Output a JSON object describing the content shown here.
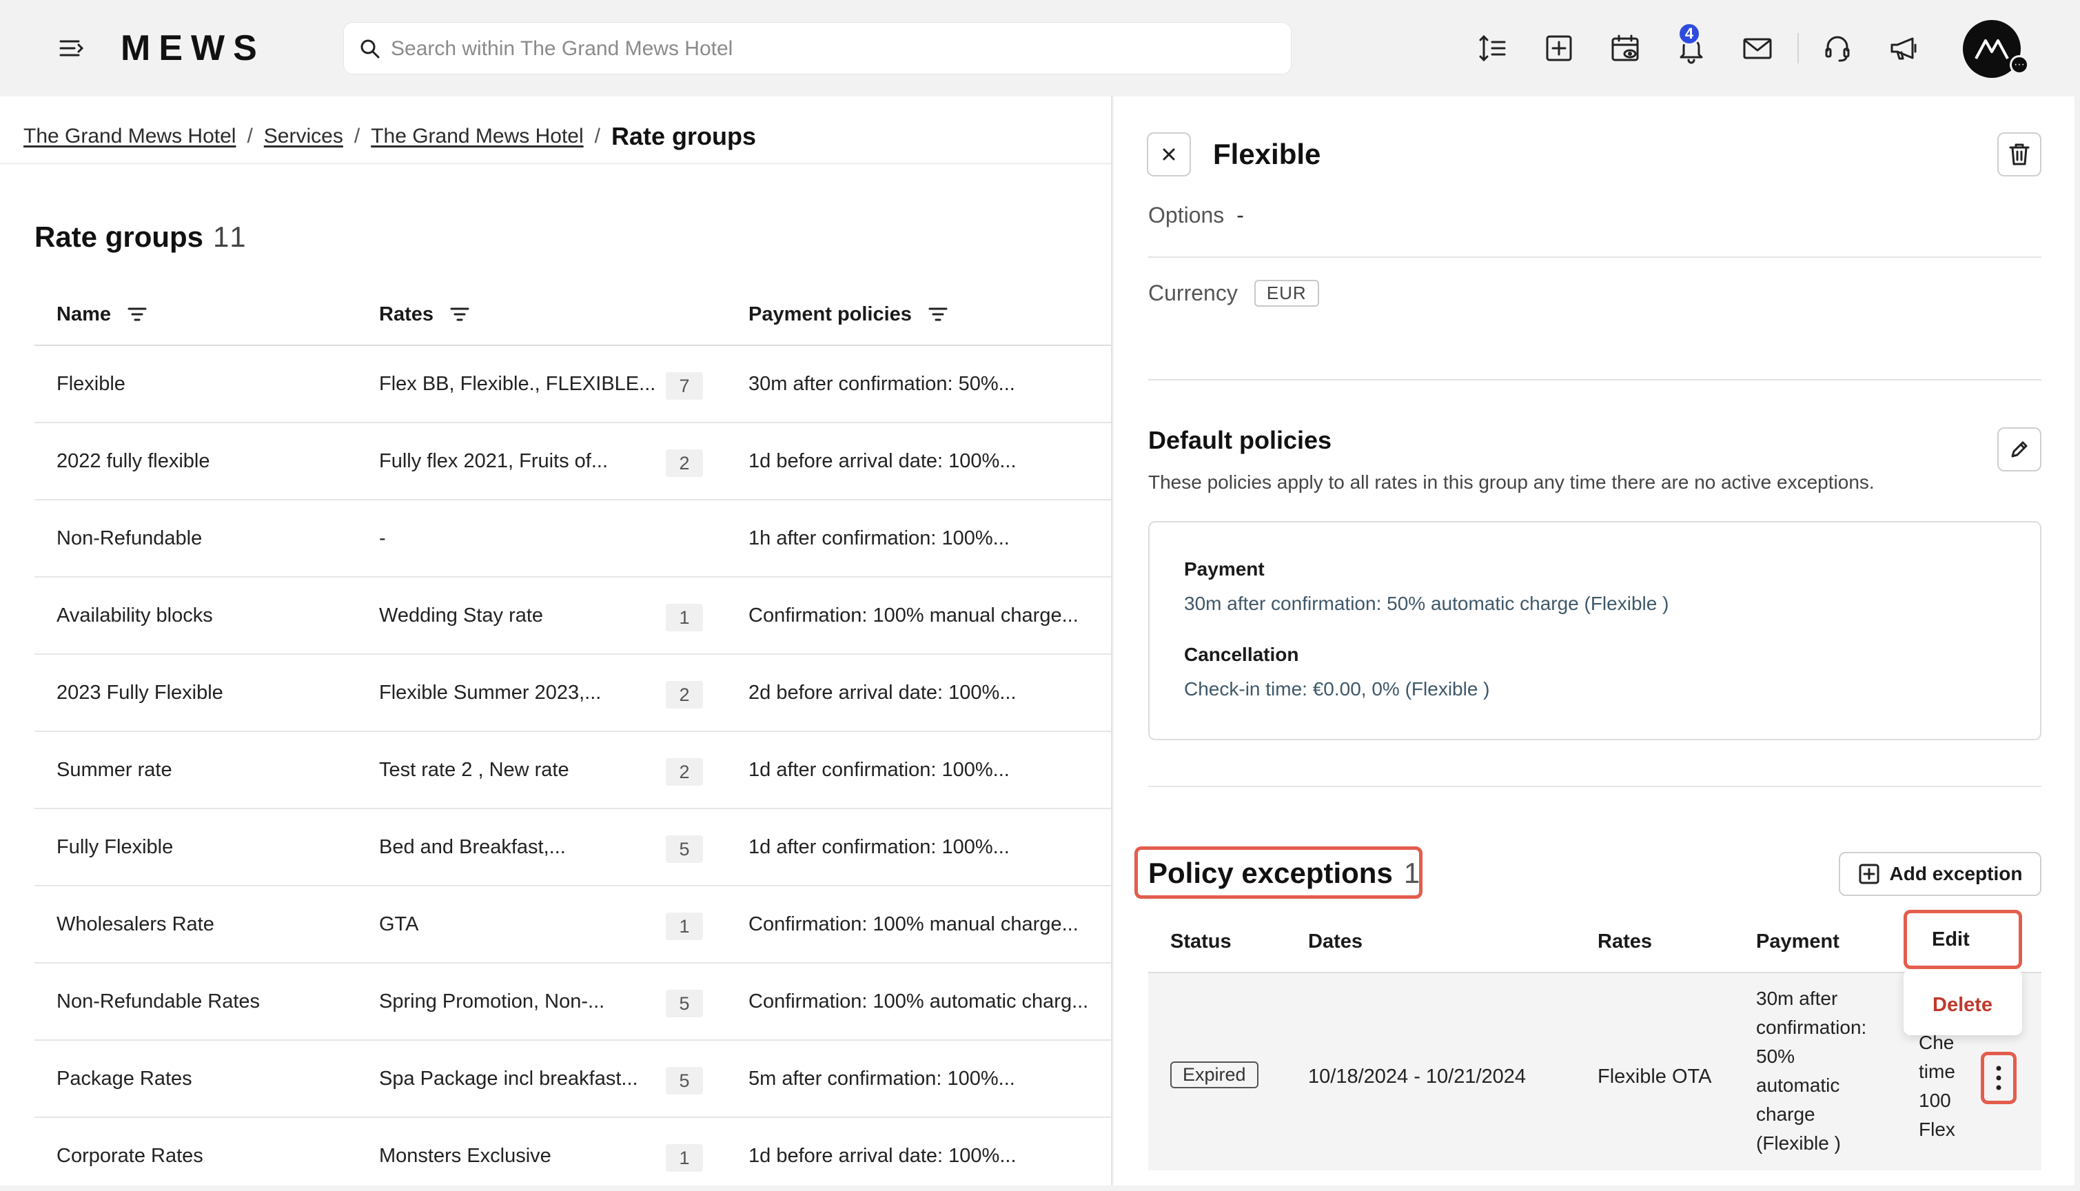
{
  "topbar": {
    "logo": "MEWS",
    "search_placeholder": "Search within The Grand Mews Hotel",
    "notification_count": "4",
    "icons": [
      "menu-icon",
      "search-icon",
      "sort-height-icon",
      "add-box-icon",
      "calendar-view-icon",
      "bell-icon",
      "mail-icon",
      "headset-icon",
      "megaphone-icon",
      "profile-avatar"
    ]
  },
  "breadcrumb": {
    "items": [
      "The Grand Mews Hotel",
      "Services",
      "The Grand Mews Hotel"
    ],
    "current": "Rate groups"
  },
  "rate_groups": {
    "title": "Rate groups",
    "count": "11",
    "columns": [
      "Name",
      "Rates",
      "Payment policies"
    ],
    "rows": [
      {
        "name": "Flexible",
        "rates": "Flex BB, Flexible., FLEXIBLE...",
        "count": "7",
        "policy": "30m after confirmation: 50%..."
      },
      {
        "name": "2022 fully flexible",
        "rates": "Fully flex 2021, Fruits of...",
        "count": "2",
        "policy": "1d before arrival date: 100%..."
      },
      {
        "name": "Non-Refundable",
        "rates": "-",
        "count": "",
        "policy": "1h after confirmation: 100%..."
      },
      {
        "name": "Availability blocks",
        "rates": "Wedding Stay rate",
        "count": "1",
        "policy": "Confirmation: 100% manual charge..."
      },
      {
        "name": "2023 Fully Flexible",
        "rates": "Flexible Summer 2023,...",
        "count": "2",
        "policy": "2d before arrival date: 100%..."
      },
      {
        "name": "Summer rate",
        "rates": "Test rate 2 , New rate",
        "count": "2",
        "policy": "1d after confirmation: 100%..."
      },
      {
        "name": "Fully Flexible",
        "rates": "Bed and Breakfast,...",
        "count": "5",
        "policy": "1d after confirmation: 100%..."
      },
      {
        "name": "Wholesalers Rate",
        "rates": "GTA",
        "count": "1",
        "policy": "Confirmation: 100% manual charge..."
      },
      {
        "name": "Non-Refundable Rates",
        "rates": "Spring Promotion, Non-...",
        "count": "5",
        "policy": "Confirmation: 100% automatic charg..."
      },
      {
        "name": "Package Rates",
        "rates": "Spa Package incl breakfast...",
        "count": "5",
        "policy": "5m after confirmation: 100%..."
      },
      {
        "name": "Corporate Rates",
        "rates": "Monsters Exclusive",
        "count": "1",
        "policy": "1d before arrival date: 100%..."
      }
    ]
  },
  "detail": {
    "title": "Flexible",
    "options_label": "Options",
    "options_value": "-",
    "currency_label": "Currency",
    "currency_value": "EUR",
    "default_policies_title": "Default policies",
    "default_policies_desc": "These policies apply to all rates in this group any time there are no active exceptions.",
    "payment_label": "Payment",
    "payment_value": "30m after confirmation: 50% automatic charge (Flexible )",
    "cancellation_label": "Cancellation",
    "cancellation_value": "Check-in time: €0.00, 0% (Flexible )",
    "exceptions_title": "Policy exceptions",
    "exceptions_count": "1",
    "add_exception_label": "Add exception",
    "exception_columns": [
      "Status",
      "Dates",
      "Rates",
      "Payment"
    ],
    "exception_row": {
      "status": "Expired",
      "dates": "10/18/2024 - 10/21/2024",
      "rates": "Flexible OTA",
      "payment_lines": [
        "30m after",
        "confirmation:",
        "50%",
        "automatic",
        "charge",
        "(Flexible )"
      ],
      "cancellation_cut_lines": [
        "Che",
        "time",
        "100",
        "Flex"
      ]
    },
    "menu": {
      "edit": "Edit",
      "delete": "Delete"
    }
  },
  "colors": {
    "highlight": "#e35d4d",
    "badge": "#2f4bde",
    "delete": "#c0392b",
    "policy_text": "#3e5869"
  }
}
